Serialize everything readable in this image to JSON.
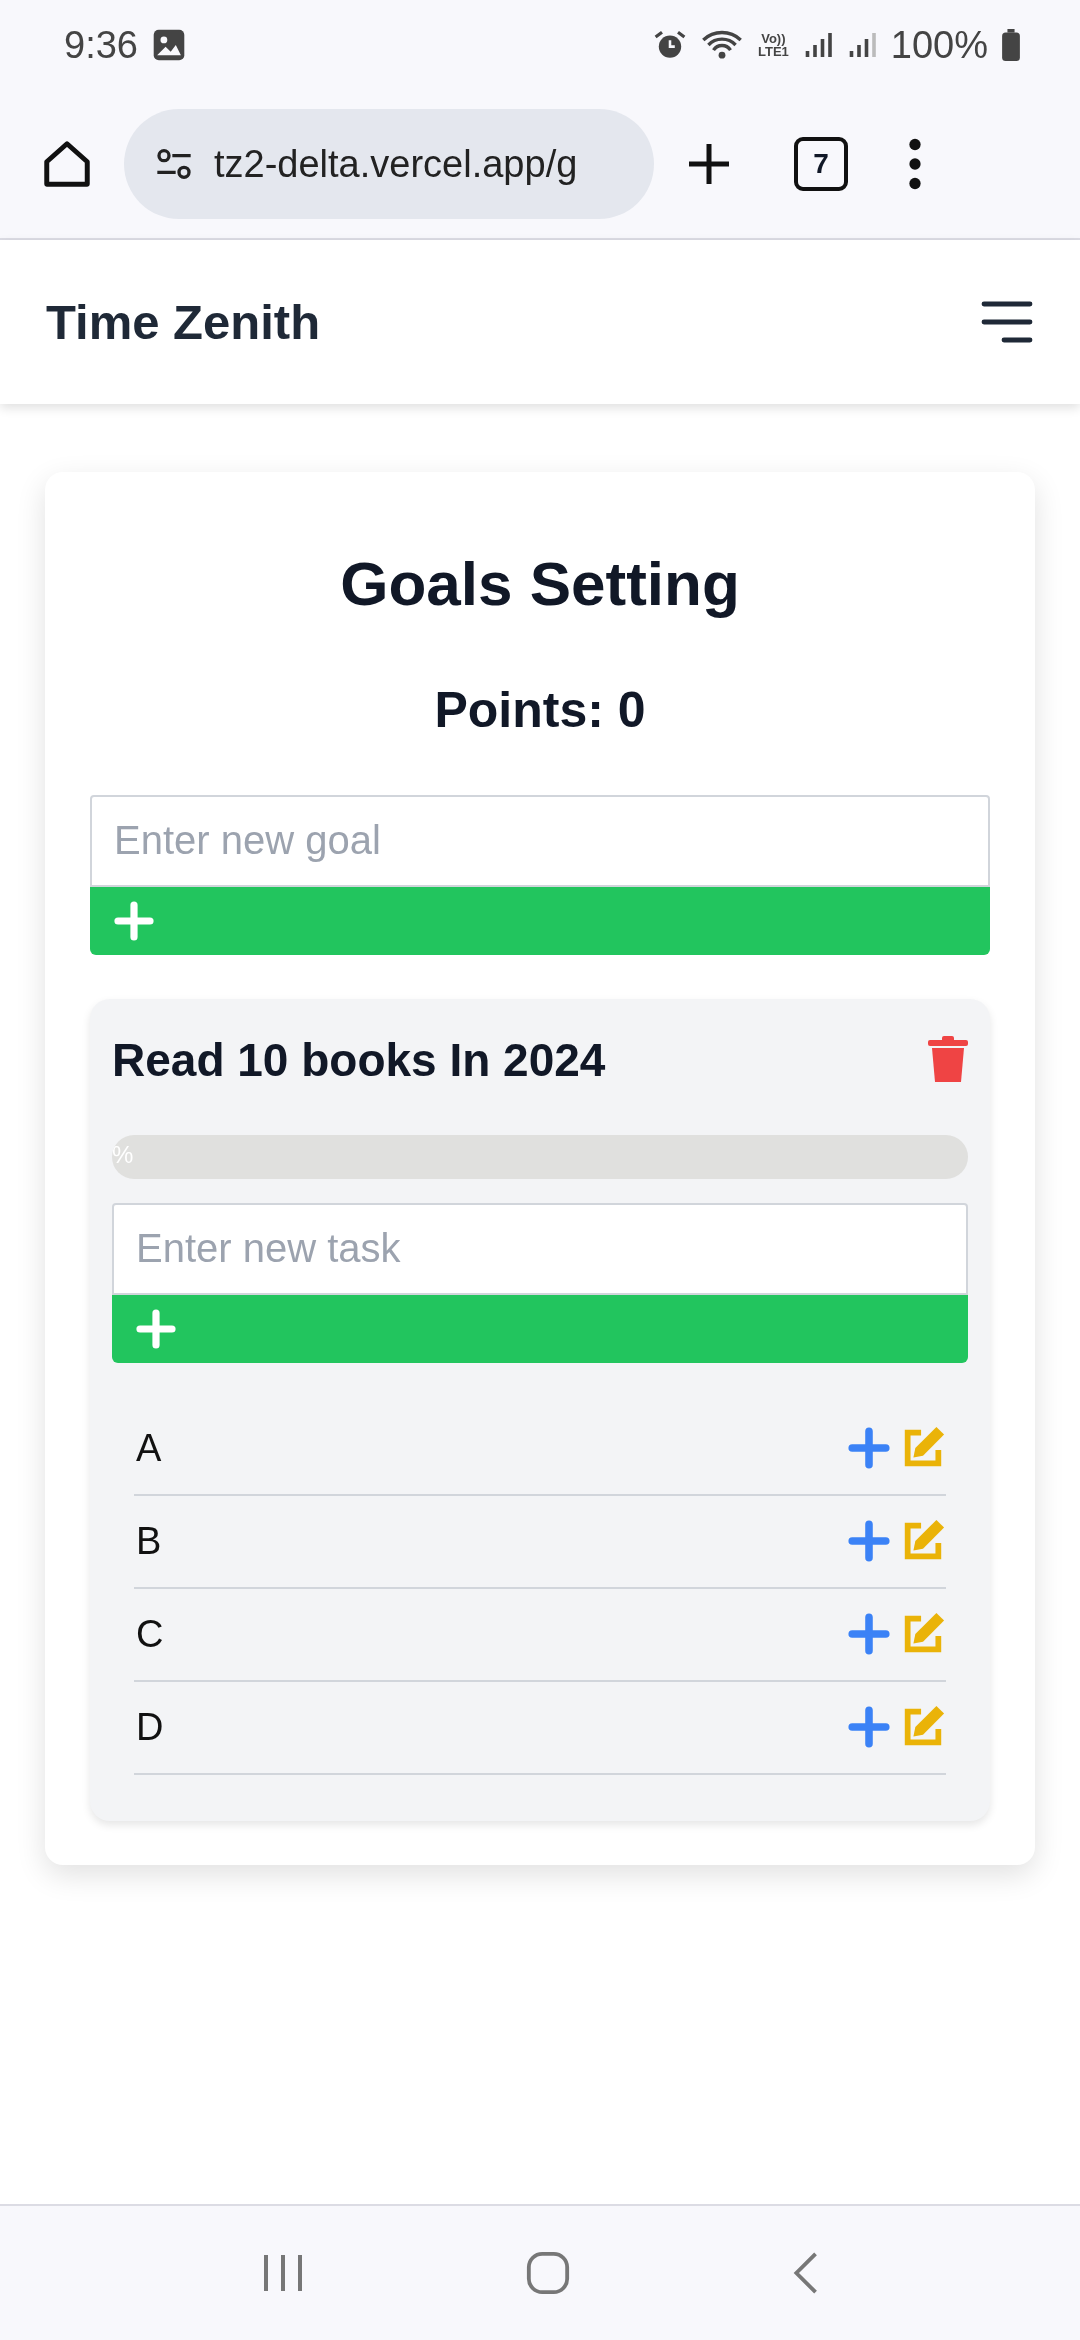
{
  "status_bar": {
    "time": "9:36",
    "network": "Vo))\nLTE1",
    "battery": "100%"
  },
  "browser": {
    "url": "tz2-delta.vercel.app/g",
    "tab_count": "7"
  },
  "app_header": {
    "title": "Time Zenith"
  },
  "goals": {
    "title": "Goals Setting",
    "points": "Points: 0",
    "new_goal": {
      "placeholder": "Enter new goal"
    },
    "items": [
      {
        "title": "Read 10 books In 2024",
        "progress": {
          "level": 0,
          "label": "%"
        },
        "new_task": {
          "placeholder": "Enter new task"
        },
        "tasks": [
          {
            "name": "A"
          },
          {
            "name": "B"
          },
          {
            "name": "C"
          },
          {
            "name": "D"
          }
        ]
      }
    ]
  }
}
